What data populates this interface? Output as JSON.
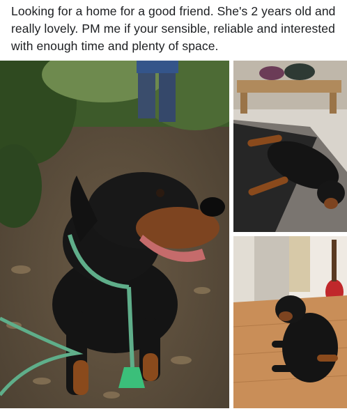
{
  "post": {
    "text": "Looking for a home for a good friend. She's 2 years old and really lovely. PM me if your sensible, reliable and interested with enough time and plenty of space."
  },
  "photos": [
    {
      "subject": "dog-sitting-on-forest-path"
    },
    {
      "subject": "dog-lying-on-rug"
    },
    {
      "subject": "dog-lying-on-wood-floor"
    }
  ],
  "colors": {
    "text": "#1c1e21",
    "background": "#ffffff",
    "dog_black": "#141414",
    "dog_tan": "#8a4a1c",
    "leash_green": "#5fae8a"
  }
}
